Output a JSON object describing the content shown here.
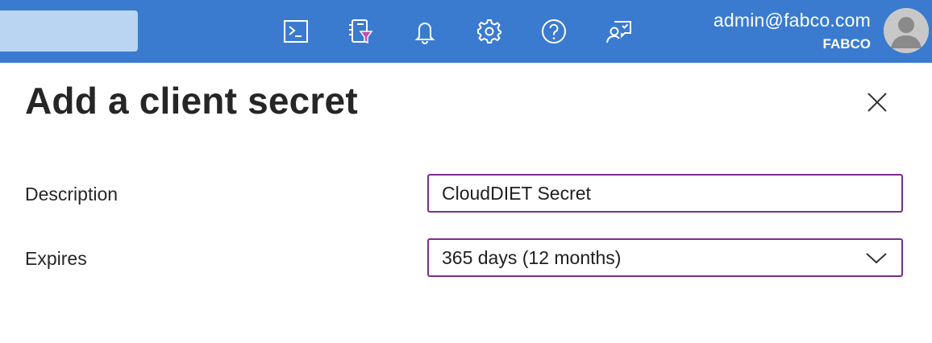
{
  "header": {
    "icons": [
      {
        "name": "cloud-shell-icon"
      },
      {
        "name": "directory-filter-icon"
      },
      {
        "name": "notifications-icon"
      },
      {
        "name": "settings-icon"
      },
      {
        "name": "help-icon"
      },
      {
        "name": "feedback-icon"
      }
    ],
    "account": {
      "email": "admin@fabco.com",
      "tenant": "FABCO"
    },
    "colors": {
      "bar": "#3a7bcf",
      "search": "#b9d5f1"
    }
  },
  "panel": {
    "title": "Add a client secret",
    "fields": {
      "description": {
        "label": "Description",
        "value": "CloudDIET Secret"
      },
      "expires": {
        "label": "Expires",
        "selected": "365 days (12 months)"
      }
    },
    "colors": {
      "input_border": "#7b2d8e"
    }
  }
}
